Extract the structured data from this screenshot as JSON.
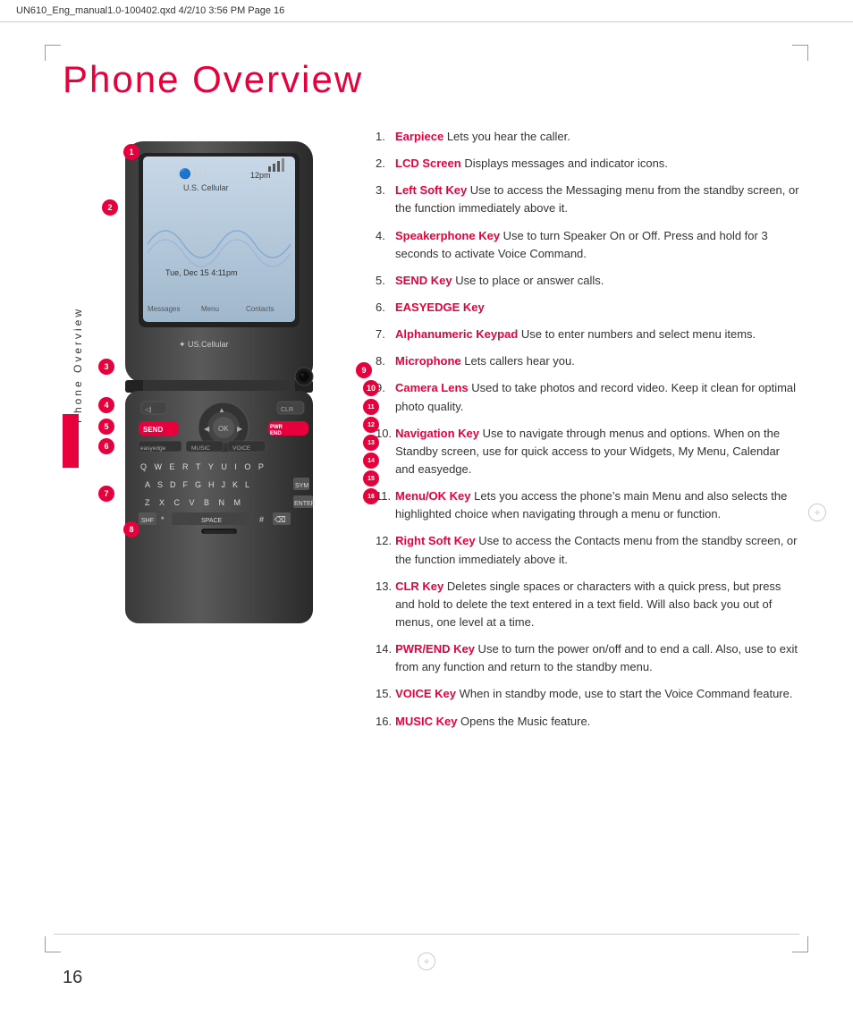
{
  "header": {
    "text": "UN610_Eng_manual1.0-100402.qxd   4/2/10   3:56 PM   Page 16"
  },
  "page": {
    "title": "Phone Overview",
    "number": "16",
    "sidebar_label": "Phone Overview"
  },
  "items": [
    {
      "num": "1.",
      "keyword": "Earpiece",
      "text": " Lets you hear the caller."
    },
    {
      "num": "2.",
      "keyword": "LCD Screen",
      "text": " Displays messages and indicator icons."
    },
    {
      "num": "3.",
      "keyword": "Left Soft Key",
      "text": " Use to access the Messaging menu from the standby screen, or the function immediately above it."
    },
    {
      "num": "4.",
      "keyword": "Speakerphone Key",
      "text": " Use to turn Speaker On or Off. Press and hold for 3 seconds to activate Voice Command."
    },
    {
      "num": "5.",
      "keyword": "SEND Key",
      "text": " Use to place or answer calls."
    },
    {
      "num": "6.",
      "keyword": "EASYEDGE Key",
      "text": ""
    },
    {
      "num": "7.",
      "keyword": "Alphanumeric Keypad",
      "text": " Use to enter numbers and select menu items."
    },
    {
      "num": "8.",
      "keyword": "Microphone",
      "text": " Lets callers hear you."
    },
    {
      "num": "9.",
      "keyword": "Camera Lens",
      "text": " Used to take photos and record video. Keep it clean for optimal photo quality."
    },
    {
      "num": "10.",
      "keyword": "Navigation Key",
      "text": " Use to navigate through menus and options. When on the Standby screen, use for quick access to your Widgets, My Menu, Calendar and easyedge."
    },
    {
      "num": "11.",
      "keyword": "Menu/OK Key",
      "text": " Lets you access the phone’s main Menu and also selects the highlighted choice when navigating through a menu or function."
    },
    {
      "num": "12.",
      "keyword": "Right Soft Key",
      "text": " Use to access the Contacts menu from the standby screen, or the function immediately above it."
    },
    {
      "num": "13.",
      "keyword": "CLR Key",
      "text": " Deletes single spaces or characters with a quick press, but press and hold to delete the text entered in a text field. Will also back you out of menus, one level at a time."
    },
    {
      "num": "14.",
      "keyword": "PWR/END Key",
      "text": " Use to turn the power on/off and to end a call. Also, use to exit from any function and return to the standby menu."
    },
    {
      "num": "15.",
      "keyword": "VOICE Key",
      "text": " When in standby mode, use to start the Voice Command feature."
    },
    {
      "num": "16.",
      "keyword": "MUSIC Key",
      "text": " Opens the Music feature."
    }
  ],
  "badges": [
    {
      "id": "b1",
      "label": "1",
      "top": "103",
      "left": "78"
    },
    {
      "id": "b2",
      "label": "2",
      "top": "170",
      "left": "50"
    },
    {
      "id": "b3",
      "label": "3",
      "top": "290",
      "left": "42"
    },
    {
      "id": "b4",
      "label": "4",
      "top": "318",
      "left": "42"
    },
    {
      "id": "b5",
      "label": "5",
      "top": "338",
      "left": "42"
    },
    {
      "id": "b6",
      "label": "6",
      "top": "358",
      "left": "42"
    },
    {
      "id": "b7",
      "label": "7",
      "top": "420",
      "left": "42"
    },
    {
      "id": "b8",
      "label": "8",
      "top": "500",
      "left": "65"
    },
    {
      "id": "b9",
      "label": "9",
      "top": "275",
      "left": "340"
    },
    {
      "id": "b10",
      "label": "10",
      "top": "295",
      "left": "350"
    },
    {
      "id": "b11",
      "label": "11",
      "top": "315",
      "left": "350"
    },
    {
      "id": "b12",
      "label": "12",
      "top": "335",
      "left": "350"
    },
    {
      "id": "b13",
      "label": "13",
      "top": "355",
      "left": "350"
    },
    {
      "id": "b14",
      "label": "14",
      "top": "375",
      "left": "350"
    },
    {
      "id": "b15",
      "label": "15",
      "top": "393",
      "left": "350"
    },
    {
      "id": "b16",
      "label": "16",
      "top": "413",
      "left": "350"
    }
  ]
}
